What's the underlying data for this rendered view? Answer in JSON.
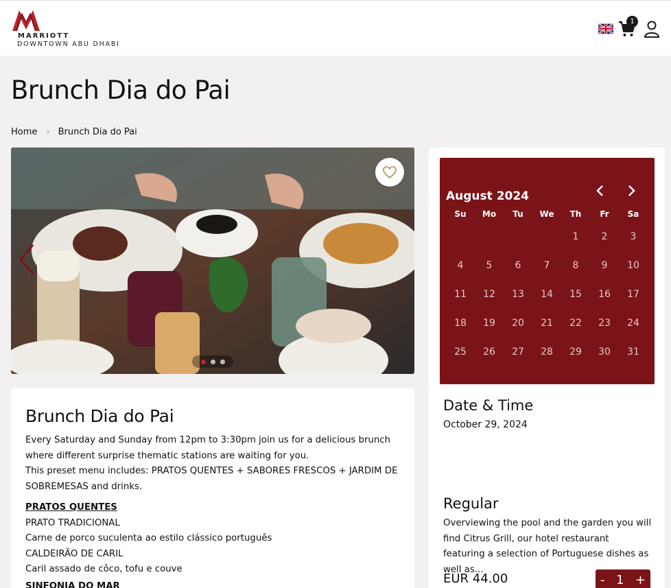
{
  "header": {
    "logo_brand": "MARRIOTT",
    "logo_sub": "DOWNTOWN ABU DHABI",
    "cart_count": "1",
    "icons": [
      "uk-flag-icon",
      "cart-icon",
      "user-icon"
    ]
  },
  "page": {
    "title": "Brunch Dia do Pai"
  },
  "breadcrumb": {
    "home": "Home",
    "current": "Brunch Dia do Pai"
  },
  "carousel": {
    "slide_count": 3,
    "active_slide": 1,
    "icons": [
      "heart-icon",
      "chevron-left-icon"
    ]
  },
  "description": {
    "title": "Brunch Dia do Pai",
    "paragraph1": "Every Saturday and Sunday from 12pm to 3:30pm join us for a delicious brunch where different surprise thematic stations are waiting for you.",
    "paragraph2": "This preset menu includes: PRATOS QUENTES + SABORES FRESCOS + JARDIM DE SOBREMESAS and drinks.",
    "section1_heading": "PRATOS QUENTES",
    "section1_lines": [
      "PRATO TRADICIONAL",
      "Carne de porco suculenta ao estilo clássico português",
      "CALDEIRÃO DE CARIL",
      "Caril assado de côco, tofu e couve"
    ],
    "section2_heading": "SINFONIA DO MAR"
  },
  "calendar": {
    "month": "August 2024",
    "weekdays": [
      "Su",
      "Mo",
      "Tu",
      "We",
      "Th",
      "Fr",
      "Sa"
    ],
    "leading_blanks": 4,
    "days": [
      "1",
      "2",
      "3",
      "4",
      "5",
      "6",
      "7",
      "8",
      "9",
      "10",
      "11",
      "12",
      "13",
      "14",
      "15",
      "16",
      "17",
      "18",
      "19",
      "20",
      "21",
      "22",
      "23",
      "24",
      "25",
      "26",
      "27",
      "28",
      "29",
      "30",
      "31"
    ],
    "accent_color": "#7a1418"
  },
  "datetime": {
    "title": "Date & Time",
    "value": "October 29, 2024"
  },
  "ticket": {
    "title": "Regular",
    "description": "Overviewing the pool and the garden you will find Citrus Grill, our hotel restaurant featuring a selection of Portuguese dishes as well as...",
    "price": "EUR 44.00",
    "quantity": "1",
    "minus": "-",
    "plus": "+"
  }
}
